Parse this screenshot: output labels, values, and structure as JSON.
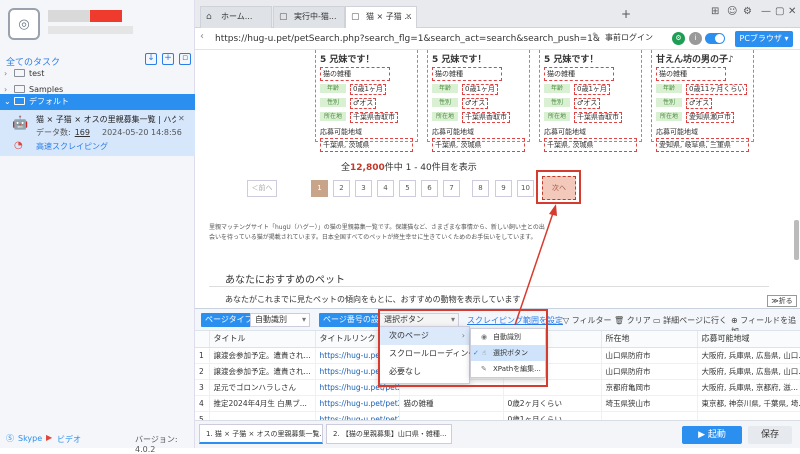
{
  "sidebar": {
    "tasks_title": "全てのタスク",
    "tree": [
      {
        "label": "test"
      },
      {
        "label": "Samples"
      },
      {
        "label": "デフォルト"
      }
    ],
    "task": {
      "name": "猫 × 子猫 × オスの里親募集一覧 | ハグー -...",
      "count_label": "データ数:",
      "count": "169",
      "date": "2024-05-20 14:8:56",
      "mode": "高速スクレイピング"
    },
    "footer": {
      "skype": "Skype",
      "video": "ビデオ",
      "version": "バージョン: 4.0.2"
    }
  },
  "browser": {
    "tabs": [
      {
        "label": "ホーム..."
      },
      {
        "label": "実行中-猫..."
      },
      {
        "label": "猫 × 子猫 ..."
      }
    ],
    "url": "https://hug-u.pet/petSearch.php?search_flg=1&search_act=search&search_push=1&pref_m...",
    "login": "事前ログイン",
    "pc_browser": "PCブラウザ"
  },
  "cards": [
    {
      "title": "5 兄妹です！",
      "sub": "猫の雑種",
      "age": "0歳1ヶ月",
      "sex": "♂オス",
      "loc": "千葉県香取市",
      "ship": "千葉県, 茨城県"
    },
    {
      "title": "5 兄妹です！",
      "sub": "猫の雑種",
      "age": "0歳1ヶ月",
      "sex": "♂オス",
      "loc": "千葉県香取市",
      "ship": "千葉県, 茨城県"
    },
    {
      "title": "5 兄妹です！",
      "sub": "猫の雑種",
      "age": "0歳1ヶ月",
      "sex": "♂オス",
      "loc": "千葉県香取市",
      "ship": "千葉県, 茨城県"
    },
    {
      "title": "甘えん坊の男の子♪",
      "sub": "猫の雑種",
      "age": "0歳11ヶ月くらい",
      "sex": "♂オス",
      "loc": "愛知県瀬戸市",
      "ship": "愛知県, 岐阜県, 三重県"
    }
  ],
  "card_labels": {
    "age": "年齢",
    "sex": "性別",
    "loc": "所在地",
    "ship": "応募可能地域"
  },
  "results": {
    "prefix": "全",
    "total": "12,800",
    "suffix": "件中 1 - 40件目を表示"
  },
  "pagination": {
    "prev": "＜前へ",
    "pages": [
      "1",
      "2",
      "3",
      "4",
      "5",
      "6",
      "7",
      "8",
      "9",
      "10"
    ],
    "next": "次ヘ"
  },
  "description": "里親マッチングサイト「hugU（ハグー）」の猫の里親募集一覧です。保護猫など、さまざまな事情から、新しい飼い主との出会いを待っている猫が掲載されています。日本全国すべてのペットが終生幸せに生きていくためのお手伝いをしています。",
  "recommend": {
    "title": "あなたにおすすめのペット",
    "desc": "あなたがこれまでに見たペットの傾向をもとに、おすすめの動物を表示しています",
    "fold": "≫折る"
  },
  "datapanel": {
    "page_type_label": "ページタイプ",
    "page_type_value": "自動識別",
    "page_num_label": "ページ番号の設定",
    "page_num_value": "選択ボタン",
    "scrape_range": "スクレイピング範囲を設定",
    "filter": "フィルター",
    "clear": "クリア",
    "detail": "詳細ページに行く",
    "add_field": "フィールドを追加",
    "columns": [
      "タイトル",
      "タイトルリンク",
      "",
      "",
      "所在地",
      "応募可能地域"
    ],
    "rows": [
      [
        "1",
        "譲渡会参加予定。遭貴され...",
        "https://hug-u.pet/pet2...",
        "",
        "",
        "山口県防府市",
        "大阪府, 兵庫県, 広島県, 山口..."
      ],
      [
        "2",
        "譲渡会参加予定。遭貴され...",
        "https://hug-u.pet/pet2...",
        "",
        "",
        "山口県防府市",
        "大阪府, 兵庫県, 広島県, 山口..."
      ],
      [
        "3",
        "足元でゴロンハラしさん",
        "https://hug-u.pet/pet2...",
        "",
        "",
        "京都府亀岡市",
        "大阪府, 兵庫県, 京都府, 滋..."
      ],
      [
        "4",
        "推定2024年4月生 白黒ブ...",
        "https://hug-u.pet/pet2405-00...",
        "猫の雑種",
        "0歳2ヶ月くらい",
        "埼玉県狭山市",
        "東京都, 神奈川県, 千葉県, 埼..."
      ],
      [
        "5",
        "",
        "https://hug-u.pet/pet2405-00...",
        "",
        "0歳1ヶ月くらい",
        "",
        ""
      ]
    ]
  },
  "dropdown1": [
    "次のページ",
    "スクロールローディング",
    "必要なし"
  ],
  "dropdown2": [
    "自動識別",
    "選択ボタン",
    "XPathを編集..."
  ],
  "bottom": {
    "tabs": [
      "1. 猫 × 子猫 × オスの里親募集一覧...",
      "2. 【猫の里親募集】山口県・雑種..."
    ],
    "start": "▶ 起動",
    "save": "保存"
  }
}
